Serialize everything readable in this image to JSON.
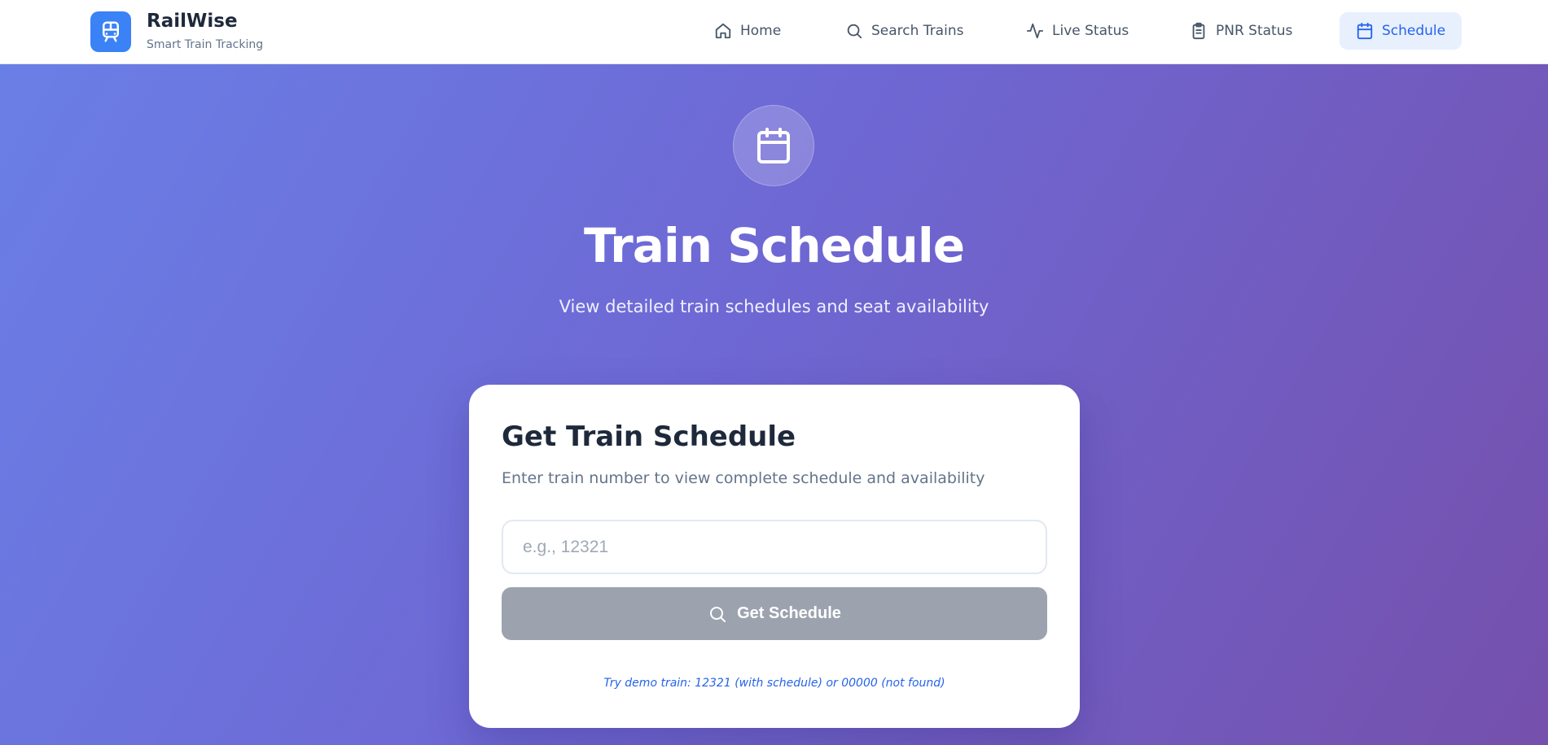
{
  "brand": {
    "name": "RailWise",
    "tagline": "Smart Train Tracking",
    "logo_icon": "train-icon",
    "color": "#3b82f6"
  },
  "nav": {
    "items": [
      {
        "label": "Home",
        "icon": "home-icon"
      },
      {
        "label": "Search Trains",
        "icon": "search-icon"
      },
      {
        "label": "Live Status",
        "icon": "activity-icon"
      },
      {
        "label": "PNR Status",
        "icon": "clipboard-icon"
      },
      {
        "label": "Schedule",
        "icon": "calendar-icon",
        "active": true
      }
    ],
    "active_color": "#2563eb"
  },
  "hero": {
    "icon": "calendar-icon",
    "title": "Train Schedule",
    "subtitle": "View detailed train schedules and seat availability",
    "gradient_colors": [
      "#6a7fe6",
      "#7550ac"
    ]
  },
  "card": {
    "title": "Get Train Schedule",
    "description": "Enter train number to view complete schedule and availability",
    "input": {
      "value": "",
      "placeholder": "e.g., 12321"
    },
    "button_label": "Get Schedule",
    "button_icon": "search-icon",
    "button_color": "#9ca3af",
    "demo_hint": "Try demo train: 12321 (with schedule) or 00000 (not found)"
  }
}
